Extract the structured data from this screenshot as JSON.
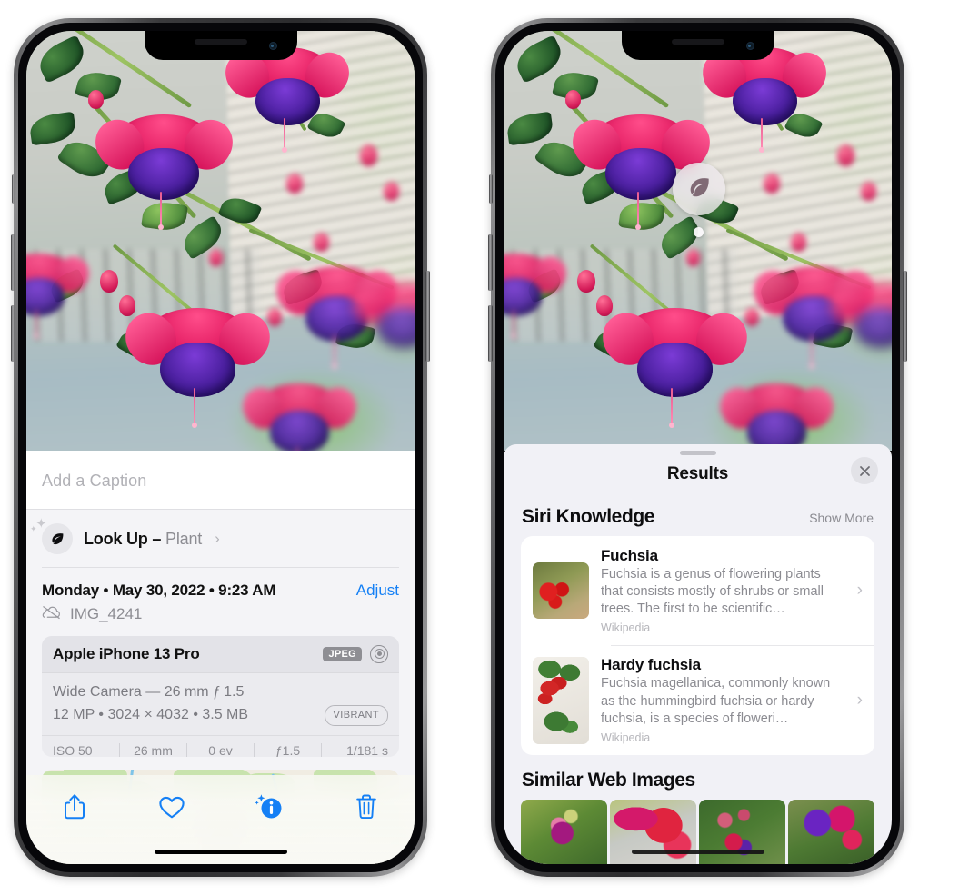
{
  "left_phone": {
    "name": "photos-detail-screen",
    "caption": {
      "placeholder": "Add a Caption",
      "value": ""
    },
    "lookup": {
      "label": "Look Up",
      "separator": "–",
      "subject": "Plant",
      "icon": "leaf-icon",
      "chevron": "›"
    },
    "date_row": {
      "date": "Monday • May 30, 2022 • 9:23 AM",
      "adjust_label": "Adjust"
    },
    "file_row": {
      "icon": "cloud-slash-icon",
      "filename": "IMG_4241"
    },
    "exif": {
      "device": "Apple iPhone 13 Pro",
      "format_badge": "JPEG",
      "raw_icon": "raw-circle-icon",
      "lens_line": "Wide Camera — 26 mm ƒ 1.5",
      "size_line": "12 MP • 3024 × 4032 • 3.5 MB",
      "profile_badge": "VIBRANT",
      "stats": [
        "ISO 50",
        "26 mm",
        "0 ev",
        "ƒ1.5",
        "1/181 s"
      ]
    },
    "map": {
      "name": "location-map",
      "pin": "photo-thumbnail-pin"
    },
    "toolbar": [
      {
        "name": "share-button",
        "icon": "share-icon"
      },
      {
        "name": "favorite-button",
        "icon": "heart-icon"
      },
      {
        "name": "info-button",
        "icon": "info-sparkle-icon"
      },
      {
        "name": "delete-button",
        "icon": "trash-icon"
      }
    ],
    "accent_color": "#1580f5"
  },
  "right_phone": {
    "name": "visual-lookup-results-screen",
    "photo_badge": {
      "icon": "leaf-icon",
      "name": "visual-lookup-badge"
    },
    "sheet": {
      "grabber": "sheet-grabber",
      "title": "Results",
      "close_icon": "close-icon"
    },
    "siri_knowledge": {
      "title": "Siri Knowledge",
      "show_more": "Show More",
      "items": [
        {
          "title": "Fuchsia",
          "description": "Fuchsia is a genus of flowering plants that consists mostly of shrubs or small trees. The first to be scientific…",
          "source": "Wikipedia",
          "chevron": "›"
        },
        {
          "title": "Hardy fuchsia",
          "description": "Fuchsia magellanica, commonly known as the hummingbird fuchsia or hardy fuchsia, is a species of floweri…",
          "source": "Wikipedia",
          "chevron": "›"
        }
      ]
    },
    "similar_web_images": {
      "title": "Similar Web Images",
      "count": 4
    },
    "panel_bg": "#f1f1f6"
  }
}
